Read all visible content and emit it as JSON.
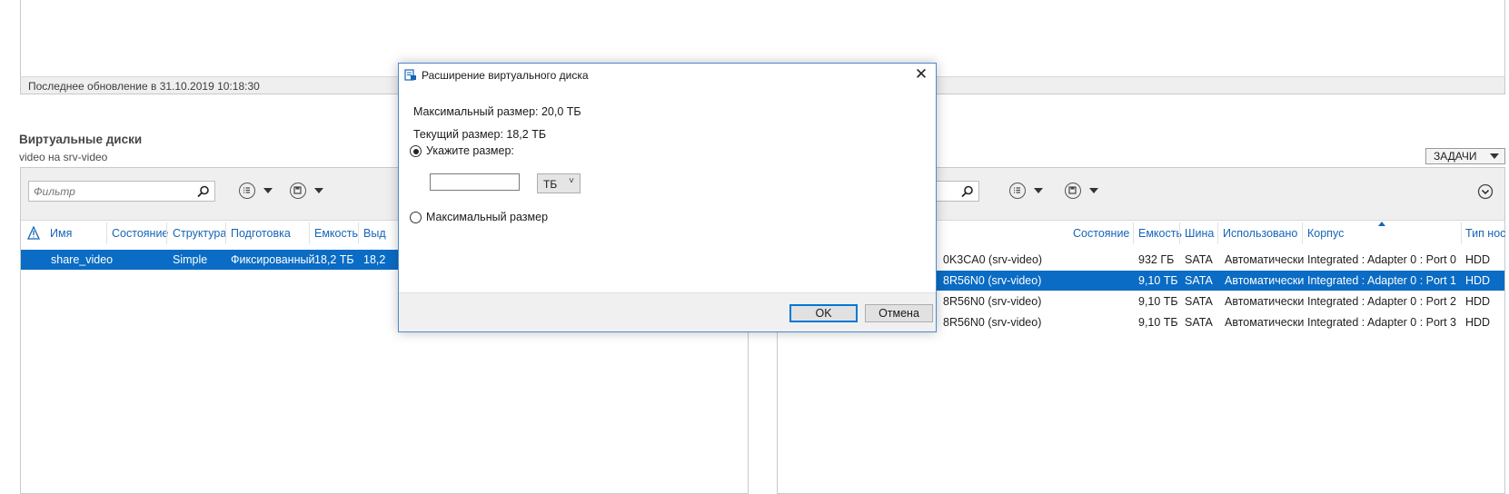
{
  "top_panel": {
    "status_text": "Последнее обновление в 31.10.2019 10:18:30"
  },
  "section": {
    "title": "Виртуальные диски",
    "subtitle": "video на srv-video",
    "tasks_label": "ЗАДАЧИ"
  },
  "left_panel": {
    "filter_placeholder": "Фильтр",
    "columns": [
      "Имя",
      "Состояние",
      "Структура",
      "Подготовка",
      "Емкость",
      "Выд"
    ],
    "rows": [
      {
        "name": "share_video",
        "state": "",
        "layout": "Simple",
        "provisioning": "Фиксированный",
        "capacity": "18,2 ТБ",
        "allocated": "18,2",
        "selected": true
      }
    ]
  },
  "right_panel": {
    "columns": [
      "Состояние",
      "Емкость",
      "Шина",
      "Использовано",
      "Корпус",
      "Тип нос"
    ],
    "rows": [
      {
        "name": "0K3CA0 (srv-video)",
        "capacity": "932 ГБ",
        "bus": "SATA",
        "usage": "Автоматически",
        "chassis": "Integrated : Adapter 0 : Port 0",
        "media": "HDD",
        "selected": false
      },
      {
        "name": "8R56N0 (srv-video)",
        "capacity": "9,10 ТБ",
        "bus": "SATA",
        "usage": "Автоматически",
        "chassis": "Integrated : Adapter 0 : Port 1",
        "media": "HDD",
        "selected": true
      },
      {
        "name": "8R56N0 (srv-video)",
        "capacity": "9,10 ТБ",
        "bus": "SATA",
        "usage": "Автоматически",
        "chassis": "Integrated : Adapter 0 : Port 2",
        "media": "HDD",
        "selected": false
      },
      {
        "name": "8R56N0 (srv-video)",
        "capacity": "9,10 ТБ",
        "bus": "SATA",
        "usage": "Автоматически",
        "chassis": "Integrated : Adapter 0 : Port 3",
        "media": "HDD",
        "selected": false
      }
    ]
  },
  "dialog": {
    "title": "Расширение виртуального диска",
    "max_size_label": "Максимальный размер: 20,0 ТБ",
    "current_size_label": "Текущий размер: 18,2 ТБ",
    "specify_size_label": "Укажите размер:",
    "size_value": "",
    "unit_value": "ТБ",
    "max_size_option_label": "Максимальный размер",
    "selected_option": "specify",
    "ok_label": "OK",
    "cancel_label": "Отмена"
  },
  "colors": {
    "accent": "#0a6cc4",
    "header_text": "#1565b8",
    "toolbar_bg": "#efefef"
  }
}
